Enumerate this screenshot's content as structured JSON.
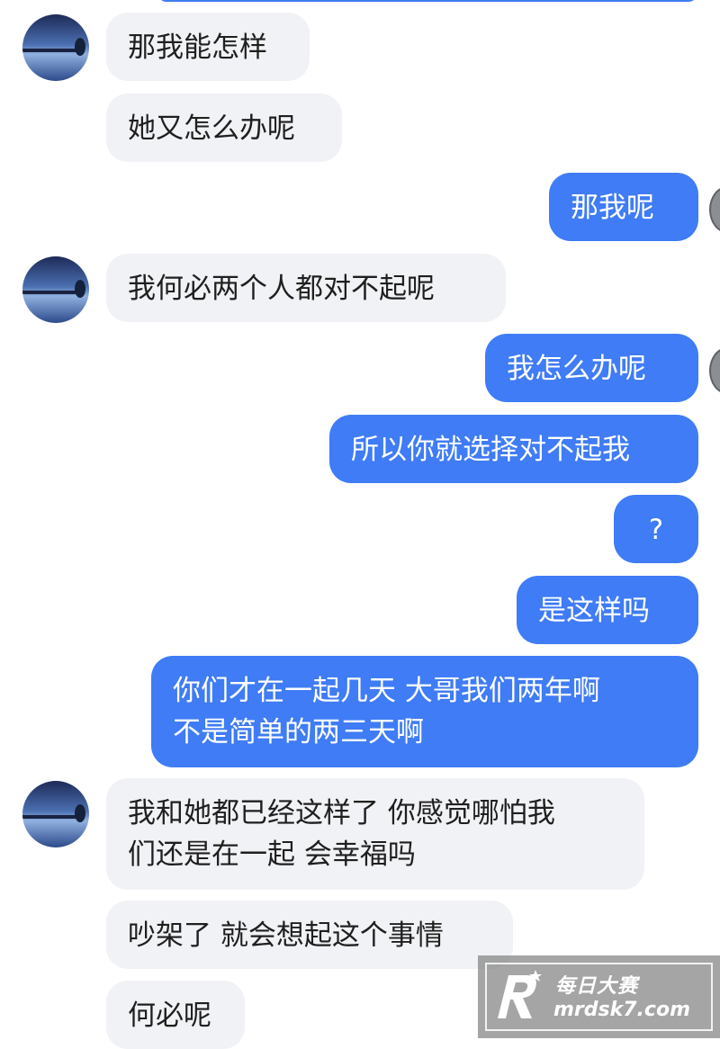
{
  "messages": [
    {
      "side": "in",
      "text": "那我能怎样"
    },
    {
      "side": "in",
      "text": "她又怎么办呢"
    },
    {
      "side": "out",
      "text": "那我呢"
    },
    {
      "side": "in",
      "text": "我何必两个人都对不起呢"
    },
    {
      "side": "out",
      "text": "我怎么办呢"
    },
    {
      "side": "out",
      "text": "所以你就选择对不起我"
    },
    {
      "side": "out",
      "text": "?"
    },
    {
      "side": "out",
      "text": "是这样吗"
    },
    {
      "side": "out",
      "text": "你们才在一起几天 大哥我们两年啊\n不是简单的两三天啊"
    },
    {
      "side": "in",
      "text": "我和她都已经这样了 你感觉哪怕我\n们还是在一起 会幸福吗"
    },
    {
      "side": "in",
      "text": "吵架了 就会想起这个事情"
    },
    {
      "side": "in",
      "text": "何必呢"
    }
  ],
  "watermark": {
    "name": "每日大赛",
    "domain": "mrdsk7.com",
    "logo_icon": "r-star-logo-icon"
  },
  "colors": {
    "outgoing_bubble": "#3f7cf5",
    "incoming_bubble": "#f1f2f5"
  }
}
